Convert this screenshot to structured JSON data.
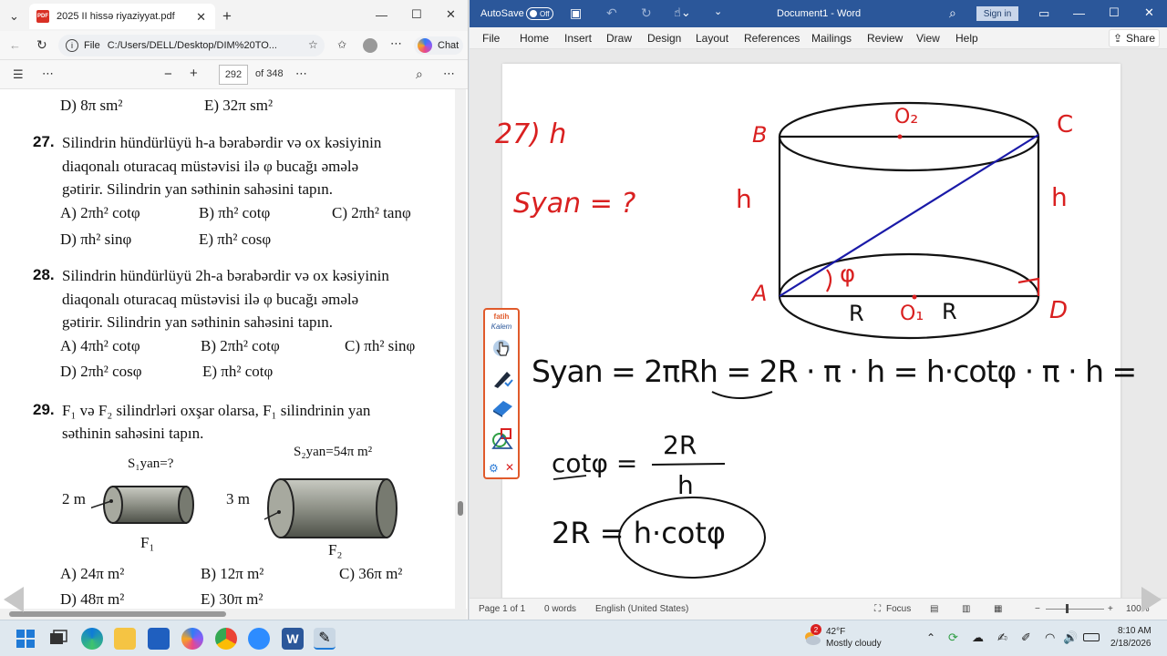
{
  "edge": {
    "tab_title": "2025 II hissə riyaziyyat.pdf",
    "address": "C:/Users/DELL/Desktop/DIM%20TO...",
    "address_prefix": "File",
    "chat_label": "Chat",
    "page_current": "292",
    "page_total": "of 348"
  },
  "pdf": {
    "prev_answers": {
      "d": "D) 8π sm²",
      "e": "E) 32π sm²"
    },
    "q27": {
      "number": "27.",
      "line1": "Silindrin hündürlüyü h-a bərabərdir və ox kəsiyinin",
      "line2": "diaqonalı oturacaq müstəvisi ilə φ bucağı əmələ",
      "line3": "gətirir. Silindrin yan səthinin sahəsini tapın.",
      "answers": [
        "A) 2πh² cotφ",
        "B) πh² cotφ",
        "C) 2πh² tanφ",
        "D) πh² sinφ",
        "E) πh² cosφ"
      ]
    },
    "q28": {
      "number": "28.",
      "line1": "Silindrin hündürlüyü 2h-a bərabərdir və ox kəsiyinin",
      "line2": "diaqonalı oturacaq müstəvisi ilə φ bucağı əmələ",
      "line3": "gətirir. Silindrin yan səthinin sahəsini tapın.",
      "answers": [
        "A) 4πh² cotφ",
        "B) 2πh² cotφ",
        "C) πh² sinφ",
        "D) 2πh² cosφ",
        "E) πh² cotφ"
      ]
    },
    "q29": {
      "number": "29.",
      "line1": "F₁ və F₂  silindrləri oxşar olarsa, F₁ silindrinin  yan",
      "line2": "səthinin sahəsini tapın.",
      "label_s1": "S₁yan=?",
      "label_s2": "S₂yan=54π m²",
      "dim1": "2 m",
      "dim2": "3 m",
      "f1": "F₁",
      "f2": "F₂",
      "answers": [
        "A) 24π m²",
        "B) 12π m²",
        "C) 36π m²",
        "D) 48π m²",
        "E) 30π m²"
      ]
    }
  },
  "word": {
    "autosave_label": "AutoSave",
    "autosave_state": "Off",
    "doc_title": "Document1 - Word",
    "signin": "Sign in",
    "menu": [
      "File",
      "Home",
      "Insert",
      "Draw",
      "Design",
      "Layout",
      "References",
      "Mailings",
      "Review",
      "View",
      "Help"
    ],
    "share": "Share",
    "status": {
      "page": "Page 1 of 1",
      "words": "0 words",
      "language": "English (United States)",
      "focus": "Focus",
      "zoom": "100%"
    }
  },
  "handwriting": {
    "problem": "27) h",
    "unknown": "Syan = ?",
    "B": "B",
    "C": "C",
    "A": "A",
    "D": "D",
    "O2": "O₂",
    "O1": "O₁",
    "h_left": "h",
    "h_right": "h",
    "phi": "φ",
    "R1": "R",
    "R2": "R",
    "eq1": "Syan = 2πRh = 2R · π · h = h·cotφ · π · h =",
    "eq2_lhs": "cotφ =",
    "eq2_num": "2R",
    "eq2_den": "h",
    "eq3": "2R = h·cotφ"
  },
  "kalem": {
    "brand_top": "fatih",
    "brand_bottom": "Kalem"
  },
  "taskbar": {
    "weather_temp": "42°F",
    "weather_desc": "Mostly cloudy",
    "weather_badge": "2",
    "time": "8:10 AM",
    "date": "2/18/2026"
  },
  "colors": {
    "word_blue": "#2b579a",
    "ink_red": "#d92020",
    "ink_blue": "#1a1aa8",
    "ink_black": "#111111",
    "kalem_orange": "#e05a2b"
  }
}
